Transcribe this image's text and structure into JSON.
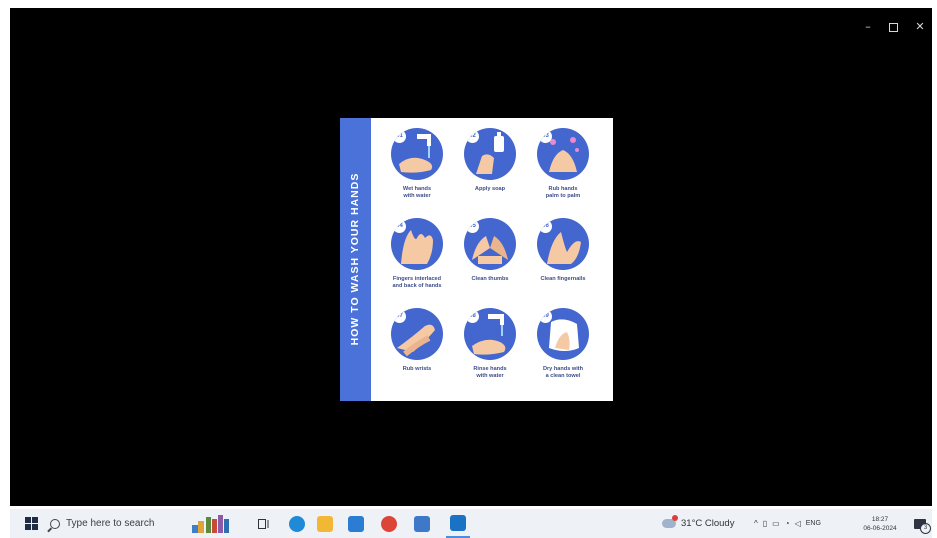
{
  "window": {
    "minimize_icon": "minimize-icon",
    "maximize_icon": "maximize-icon",
    "close_icon": "close-icon"
  },
  "poster": {
    "title": "HOW TO WASH YOUR HANDS",
    "colors": {
      "band": "#4b72d8",
      "circle": "#4366cf",
      "caption": "#3d4c88"
    },
    "steps": [
      {
        "num": "01",
        "caption": "Wet hands\nwith water"
      },
      {
        "num": "02",
        "caption": "Apply soap"
      },
      {
        "num": "03",
        "caption": "Rub hands\npalm to palm"
      },
      {
        "num": "04",
        "caption": "Fingers interlaced\nand back of hands"
      },
      {
        "num": "05",
        "caption": "Clean thumbs"
      },
      {
        "num": "06",
        "caption": "Clean fingernails"
      },
      {
        "num": "07",
        "caption": "Rub wrists"
      },
      {
        "num": "08",
        "caption": "Rinse hands\nwith water"
      },
      {
        "num": "09",
        "caption": "Dry hands with\na clean towel"
      }
    ]
  },
  "taskbar": {
    "search_placeholder": "Type here to search",
    "weather": "31°C  Cloudy",
    "language": "ENG",
    "time": "18:27",
    "date": "06-06-2024",
    "notification_count": "3",
    "apps": [
      {
        "name": "edge-icon",
        "color": "#1f8ad6"
      },
      {
        "name": "file-explorer-icon",
        "color": "#f2b734"
      },
      {
        "name": "mail-icon",
        "color": "#2b7cd3"
      },
      {
        "name": "chrome-icon",
        "color": "#db4437"
      },
      {
        "name": "photos-icon",
        "color": "#3d78c9"
      },
      {
        "name": "media-icon",
        "color": "#1a72c4"
      }
    ]
  }
}
